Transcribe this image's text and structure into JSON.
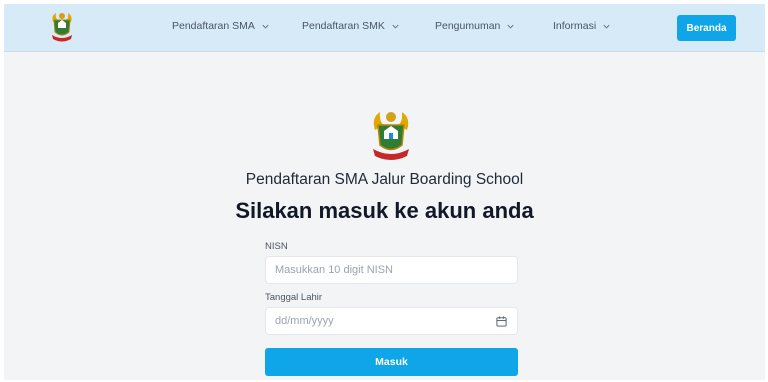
{
  "navbar": {
    "logo": "provincial-emblem",
    "items": [
      {
        "label": "Pendaftaran SMA",
        "icon": "chevron-down-icon"
      },
      {
        "label": "Pendaftaran SMK",
        "icon": "chevron-down-icon"
      },
      {
        "label": "Pengumuman",
        "icon": "chevron-down-icon"
      },
      {
        "label": "Informasi",
        "icon": "chevron-down-icon"
      }
    ],
    "home_button": "Beranda"
  },
  "login": {
    "emblem": "provincial-emblem",
    "subtitle": "Pendaftaran SMA Jalur Boarding School",
    "title": "Silakan masuk ke akun anda",
    "nisn": {
      "label": "NISN",
      "placeholder": "Masukkan 10 digit NISN"
    },
    "birthdate": {
      "label": "Tanggal Lahir",
      "placeholder": "dd/mm/yyyy",
      "icon": "calendar-icon"
    },
    "submit_label": "Masuk"
  },
  "colors": {
    "accent": "#0ea5e9",
    "navbar_bg": "#d6eaf8",
    "page_bg": "#f3f4f6"
  }
}
